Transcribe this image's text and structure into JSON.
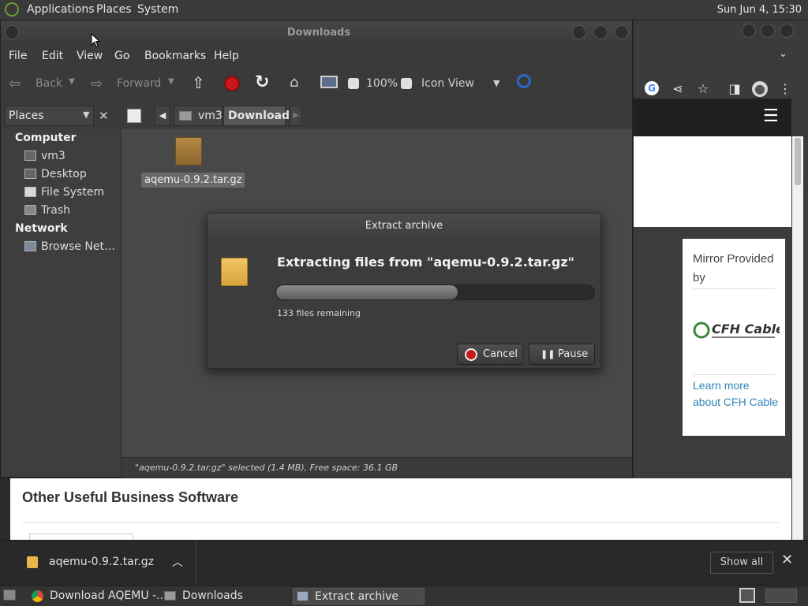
{
  "top_panel": {
    "menus": [
      "Applications",
      "Places",
      "System"
    ],
    "clock": "Sun Jun  4, 15:30"
  },
  "file_manager": {
    "title": "Downloads",
    "menubar": [
      "File",
      "Edit",
      "View",
      "Go",
      "Bookmarks",
      "Help"
    ],
    "toolbar": {
      "back": "Back",
      "forward": "Forward",
      "zoom": "100%",
      "view_mode": "Icon View"
    },
    "location": {
      "places_label": "Places",
      "crumbs": [
        "vm3",
        "Downloads"
      ]
    },
    "sidebar": {
      "computer_heading": "Computer",
      "computer_items": [
        "vm3",
        "Desktop",
        "File System",
        "Trash"
      ],
      "network_heading": "Network",
      "network_items": [
        "Browse Net…"
      ]
    },
    "files": [
      {
        "name": "aqemu-0.9.2.tar.gz",
        "selected": true
      }
    ],
    "status": "\"aqemu-0.9.2.tar.gz\" selected (1.4 MB), Free space: 36.1 GB"
  },
  "dialog": {
    "title": "Extract archive",
    "heading": "Extracting files from \"aqemu-0.9.2.tar.gz\"",
    "progress": 0.57,
    "remaining": "133 files remaining",
    "cancel_label": "Cancel",
    "pause_label": "Pause"
  },
  "browser": {
    "mirror_title": "Mirror Provided by",
    "logo_text": "CFH Cable",
    "link_text": "Learn more about CFH Cable",
    "section_heading": "Other Useful Business Software"
  },
  "download_bar": {
    "filename": "aqemu-0.9.2.tar.gz",
    "show_all": "Show all"
  },
  "taskbar": {
    "tasks": [
      "Download AQEMU -...",
      "Downloads",
      "Extract archive"
    ]
  },
  "colors": {
    "accent_link": "#2e86b8",
    "stop_red": "#c8171d"
  }
}
